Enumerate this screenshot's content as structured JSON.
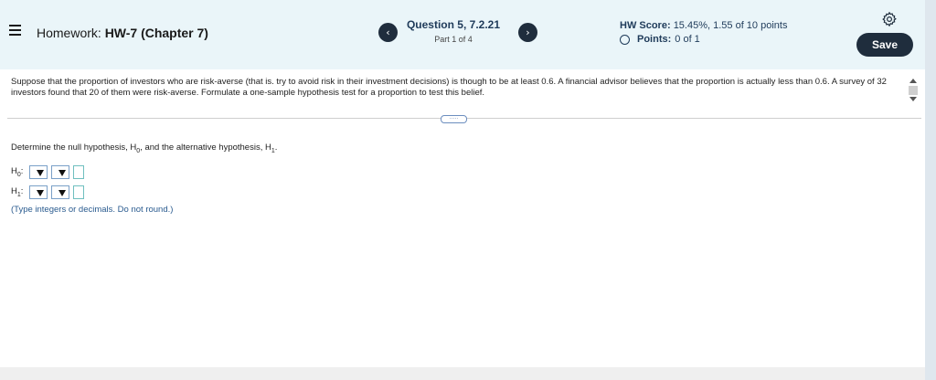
{
  "header": {
    "homework_prefix": "Homework:",
    "homework_name": "HW-7 (Chapter 7)",
    "prev_label": "‹",
    "next_label": "›",
    "question_title": "Question 5, 7.2.21",
    "question_part": "Part 1 of 4",
    "score_label": "HW Score:",
    "score_value": "15.45%, 1.55 of 10 points",
    "points_label": "Points:",
    "points_value": "0 of 1",
    "save_label": "Save",
    "settings_icon": "gear-icon",
    "menu_icon": "hamburger-icon"
  },
  "problem": {
    "text": "Suppose that the proportion of investors who are risk-averse (that is. try to avoid risk in their investment decisions) is though to be at least 0.6. A financial advisor believes that the proportion is actually less than 0.6. A survey of 32 investors found that 20 of them were risk-averse. Formulate a one-sample hypothesis test for a proportion to test this belief.",
    "expander_label": "·····"
  },
  "question": {
    "instruction_a": "Determine the null hypothesis, H",
    "instruction_sub0": "0",
    "instruction_b": ", and the alternative hypothesis, H",
    "instruction_sub1": "1",
    "instruction_c": ".",
    "h0_label": "H",
    "h0_sub": "0",
    "h1_label": "H",
    "h1_sub": "1",
    "colon": ":",
    "hint": "(Type integers or decimals. Do not round.)"
  },
  "colors": {
    "header_bg": "#eaf5f9",
    "button_dark": "#1f2d3d",
    "text_blue": "#1f3b5a",
    "hint_blue": "#2a5b8f"
  }
}
